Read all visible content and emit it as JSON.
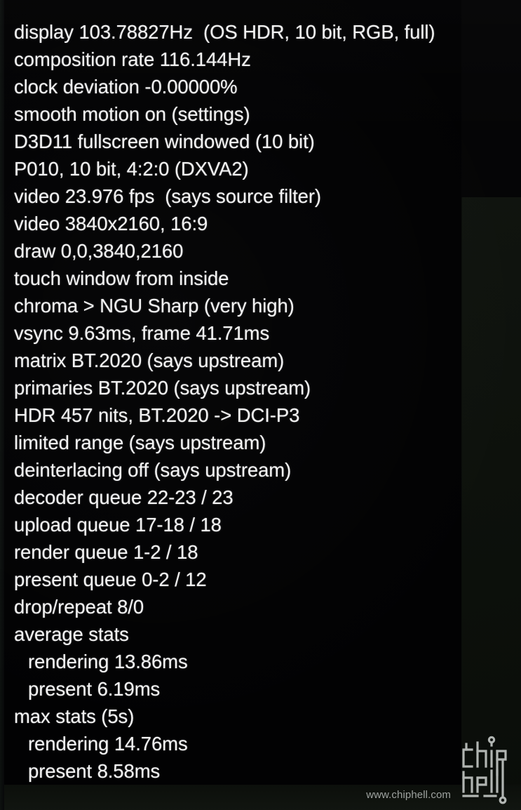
{
  "overlay": {
    "name": "madVR rendering statistics OSD",
    "text_color": "#f4f4f4",
    "background_color": "#020203",
    "lines": [
      {
        "text": "display 103.78827Hz  (OS HDR, 10 bit, RGB, full)",
        "indent": false,
        "name": "osd-line-display"
      },
      {
        "text": "composition rate 116.144Hz",
        "indent": false,
        "name": "osd-line-composition-rate"
      },
      {
        "text": "clock deviation -0.00000%",
        "indent": false,
        "name": "osd-line-clock-deviation"
      },
      {
        "text": "smooth motion on (settings)",
        "indent": false,
        "name": "osd-line-smooth-motion"
      },
      {
        "text": "D3D11 fullscreen windowed (10 bit)",
        "indent": false,
        "name": "osd-line-present-mode"
      },
      {
        "text": "P010, 10 bit, 4:2:0 (DXVA2)",
        "indent": false,
        "name": "osd-line-pixel-format"
      },
      {
        "text": "video 23.976 fps  (says source filter)",
        "indent": false,
        "name": "osd-line-video-fps"
      },
      {
        "text": "video 3840x2160, 16:9",
        "indent": false,
        "name": "osd-line-video-resolution"
      },
      {
        "text": "draw 0,0,3840,2160",
        "indent": false,
        "name": "osd-line-draw-rect"
      },
      {
        "text": "touch window from inside",
        "indent": false,
        "name": "osd-line-touch-window"
      },
      {
        "text": "chroma > NGU Sharp (very high)",
        "indent": false,
        "name": "osd-line-chroma-upscaling"
      },
      {
        "text": "vsync 9.63ms, frame 41.71ms",
        "indent": false,
        "name": "osd-line-vsync-frame"
      },
      {
        "text": "matrix BT.2020 (says upstream)",
        "indent": false,
        "name": "osd-line-matrix"
      },
      {
        "text": "primaries BT.2020 (says upstream)",
        "indent": false,
        "name": "osd-line-primaries"
      },
      {
        "text": "HDR 457 nits, BT.2020 -> DCI-P3",
        "indent": false,
        "name": "osd-line-hdr"
      },
      {
        "text": "limited range (says upstream)",
        "indent": false,
        "name": "osd-line-range"
      },
      {
        "text": "deinterlacing off (says upstream)",
        "indent": false,
        "name": "osd-line-deinterlacing"
      },
      {
        "text": "decoder queue 22-23 / 23",
        "indent": false,
        "name": "osd-line-decoder-queue"
      },
      {
        "text": "upload queue 17-18 / 18",
        "indent": false,
        "name": "osd-line-upload-queue"
      },
      {
        "text": "render queue 1-2 / 18",
        "indent": false,
        "name": "osd-line-render-queue"
      },
      {
        "text": "present queue 0-2 / 12",
        "indent": false,
        "name": "osd-line-present-queue"
      },
      {
        "text": "drop/repeat 8/0",
        "indent": false,
        "name": "osd-line-drop-repeat"
      },
      {
        "text": "average stats",
        "indent": false,
        "name": "osd-line-average-stats-header"
      },
      {
        "text": "rendering 13.86ms",
        "indent": true,
        "name": "osd-line-average-rendering"
      },
      {
        "text": "present 6.19ms",
        "indent": true,
        "name": "osd-line-average-present"
      },
      {
        "text": "max stats (5s)",
        "indent": false,
        "name": "osd-line-max-stats-header"
      },
      {
        "text": "rendering 14.76ms",
        "indent": true,
        "name": "osd-line-max-rendering"
      },
      {
        "text": "present 8.58ms",
        "indent": true,
        "name": "osd-line-max-present"
      }
    ]
  },
  "watermark": {
    "url": "www.chiphell.com",
    "logo_name": "chiphell-logo",
    "color": "#d6dad8"
  }
}
